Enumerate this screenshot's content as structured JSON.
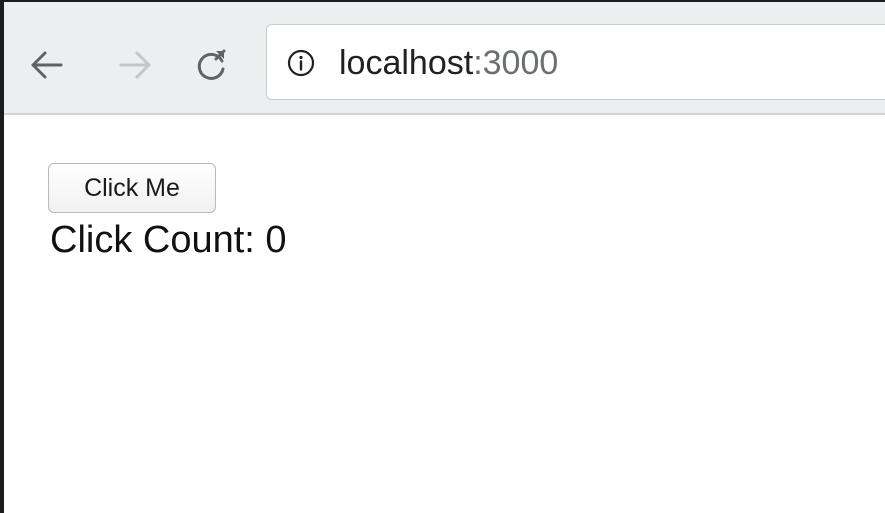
{
  "browser": {
    "url_host": "localhost",
    "url_port": ":3000",
    "back_icon": "arrow-left-icon",
    "forward_icon": "arrow-right-icon",
    "reload_icon": "reload-icon",
    "site_info_icon": "info-icon"
  },
  "page": {
    "button_label": "Click Me",
    "count_label": "Click Count: ",
    "count_value": "0"
  },
  "colors": {
    "toolbar": "#edeef0",
    "icon_active": "#5f6368",
    "icon_disabled": "#c3c6ca"
  }
}
